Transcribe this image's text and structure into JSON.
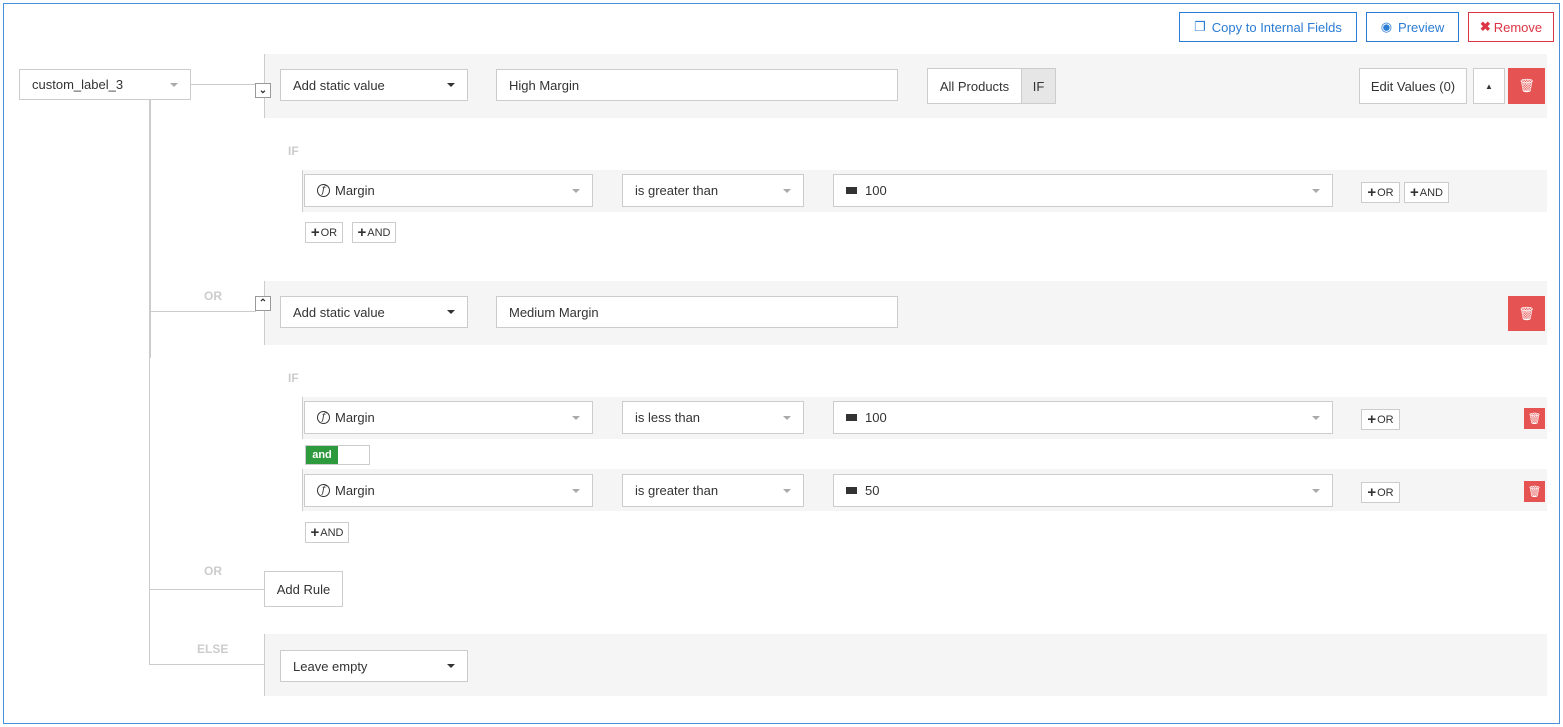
{
  "toolbar": {
    "copy": "Copy to Internal Fields",
    "preview": "Preview",
    "remove": "Remove"
  },
  "field": "custom_label_3",
  "rules": [
    {
      "type": "Add static value",
      "value": "High Margin",
      "scope": "All Products",
      "scope_if": "IF",
      "edit_values": "Edit Values (0)",
      "if_label": "IF",
      "conditions": [
        {
          "field": "Margin",
          "operator": "is greater than",
          "value": "100"
        }
      ]
    },
    {
      "connector": "OR",
      "type": "Add static value",
      "value": "Medium Margin",
      "if_label": "IF",
      "conditions": [
        {
          "field": "Margin",
          "operator": "is less than",
          "value": "100"
        },
        {
          "field": "Margin",
          "operator": "is greater than",
          "value": "50"
        }
      ],
      "toggle": "and"
    }
  ],
  "small": {
    "or": "OR",
    "and": "AND"
  },
  "add_rule": {
    "connector": "OR",
    "label": "Add Rule"
  },
  "else": {
    "label": "ELSE",
    "value": "Leave empty"
  }
}
